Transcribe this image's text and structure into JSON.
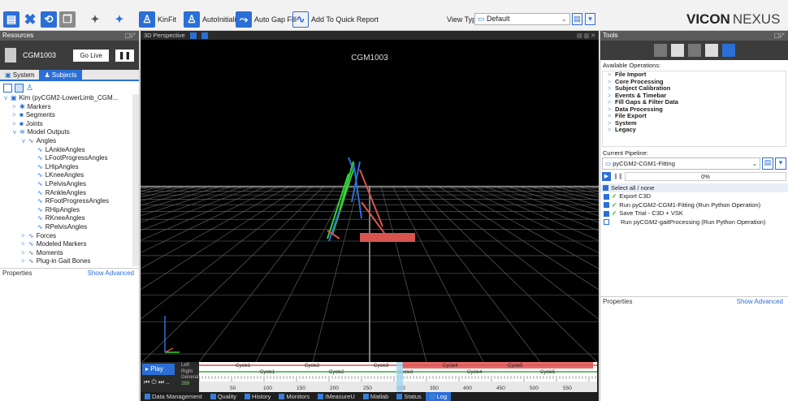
{
  "toolbar": {
    "kinfit": "KinFit",
    "autoinit": "AutoInitialize",
    "autogap": "Auto Gap Fill",
    "quickreport": "Add To Quick Report",
    "viewtype_label": "View Type:",
    "viewtype_value": "Default",
    "brand": "VICON",
    "brand2": "NEXUS"
  },
  "resources": {
    "title": "Resources",
    "subject_name": "CGM1003",
    "golive": "Go Live",
    "tabs": [
      "System",
      "Subjects"
    ]
  },
  "tree": [
    {
      "indent": 0,
      "arrow": "∨",
      "icon": "▣",
      "label": "Kim (pyCGM2-LowerLimb_CGM..."
    },
    {
      "indent": 1,
      "arrow": ">",
      "icon": "✱",
      "label": "Markers"
    },
    {
      "indent": 1,
      "arrow": ">",
      "icon": "■",
      "label": "Segments"
    },
    {
      "indent": 1,
      "arrow": ">",
      "icon": "■",
      "label": "Joints"
    },
    {
      "indent": 1,
      "arrow": "∨",
      "icon": "≋",
      "label": "Model Outputs"
    },
    {
      "indent": 2,
      "arrow": "∨",
      "icon": "∿",
      "label": "Angles"
    },
    {
      "indent": 3,
      "arrow": "",
      "icon": "∿",
      "label": "LAnkleAngles"
    },
    {
      "indent": 3,
      "arrow": "",
      "icon": "∿",
      "label": "LFootProgressAngles"
    },
    {
      "indent": 3,
      "arrow": "",
      "icon": "∿",
      "label": "LHipAngles"
    },
    {
      "indent": 3,
      "arrow": "",
      "icon": "∿",
      "label": "LKneeAngles"
    },
    {
      "indent": 3,
      "arrow": "",
      "icon": "∿",
      "label": "LPelvisAngles"
    },
    {
      "indent": 3,
      "arrow": "",
      "icon": "∿",
      "label": "RAnkleAngles"
    },
    {
      "indent": 3,
      "arrow": "",
      "icon": "∿",
      "label": "RFootProgressAngles"
    },
    {
      "indent": 3,
      "arrow": "",
      "icon": "∿",
      "label": "RHipAngles"
    },
    {
      "indent": 3,
      "arrow": "",
      "icon": "∿",
      "label": "RKneeAngles"
    },
    {
      "indent": 3,
      "arrow": "",
      "icon": "∿",
      "label": "RPelvisAngles"
    },
    {
      "indent": 2,
      "arrow": ">",
      "icon": "∿",
      "label": "Forces"
    },
    {
      "indent": 2,
      "arrow": ">",
      "icon": "∿",
      "label": "Modeled Markers"
    },
    {
      "indent": 2,
      "arrow": ">",
      "icon": "∿",
      "label": "Moments"
    },
    {
      "indent": 2,
      "arrow": ">",
      "icon": "∿",
      "label": "Plug-in Gait Bones"
    }
  ],
  "properties": {
    "title": "Properties",
    "show_advanced": "Show Advanced"
  },
  "view": {
    "tab": "3D Perspective",
    "subject_label": "CGM1003"
  },
  "tools": {
    "title": "Tools",
    "available_ops": "Available Operations:",
    "ops": [
      "File Import",
      "Core Processing",
      "Subject Calibration",
      "Events & Timebar",
      "Fill Gaps & Filter Data",
      "Data Processing",
      "File Export",
      "System",
      "Legacy"
    ],
    "current_pipeline": "Current Pipeline:",
    "pipeline_value": "pyCGM2-CGM1-Fitting",
    "progress": "0%",
    "select_all": "Select all / none",
    "steps": [
      {
        "checked": true,
        "done": true,
        "label": "Export C3D"
      },
      {
        "checked": true,
        "done": true,
        "label": "Run pyCGM2-CGM1-Fitting (Run Python Operation)"
      },
      {
        "checked": true,
        "done": true,
        "label": "Save Trial - C3D + VSK"
      },
      {
        "checked": false,
        "done": false,
        "label": "Run pyCGM2-gaitProcessing (Run Python Operation)"
      }
    ],
    "properties": "Properties",
    "show_advanced": "Show Advanced"
  },
  "timeline": {
    "play": "Play",
    "rows": [
      "Left",
      "Right",
      "General"
    ],
    "frame": "289",
    "ticks": [
      "50",
      "100",
      "150",
      "200",
      "250",
      "300",
      "350",
      "400",
      "450",
      "500",
      "550"
    ],
    "cycles_top": [
      "Cycle1",
      "Cycle2",
      "Cycle3",
      "Cycle4",
      "Cycle5"
    ],
    "cycles_bottom": [
      "Cycle1",
      "Cycle2",
      "Cycle3",
      "Cycle4",
      "Cycle5"
    ]
  },
  "bottom_tabs": [
    "Data Management",
    "Quality",
    "History",
    "Monitors",
    "IMeasureU",
    "Matlab",
    "Status",
    "Log"
  ]
}
